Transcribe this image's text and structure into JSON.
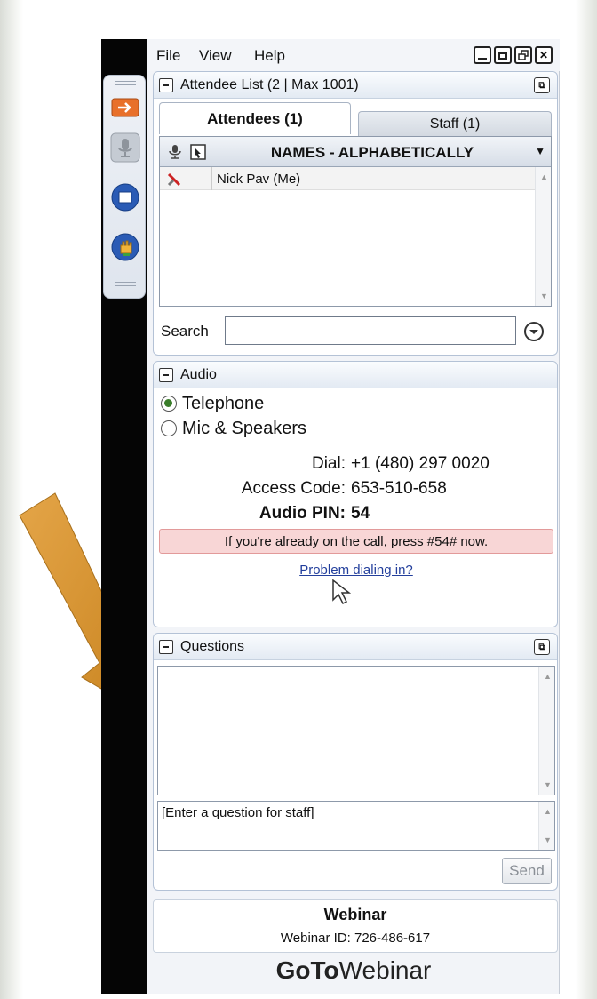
{
  "menu": {
    "file": "File",
    "view": "View",
    "help": "Help"
  },
  "attendee_section": {
    "title": "Attendee List  (2 | Max 1001)",
    "tabs": [
      {
        "label": "Attendees (1)"
      },
      {
        "label": "Staff (1)"
      }
    ],
    "column_header": "NAMES - ALPHABETICALLY",
    "rows": [
      {
        "name": "Nick Pav (Me)"
      }
    ],
    "search_label": "Search",
    "search_value": ""
  },
  "audio_section": {
    "title": "Audio",
    "options": [
      {
        "label": "Telephone",
        "selected": true
      },
      {
        "label": "Mic & Speakers",
        "selected": false
      }
    ],
    "dial_label": "Dial:",
    "dial_value": "+1 (480) 297 0020",
    "access_label": "Access Code:",
    "access_value": "653-510-658",
    "pin_label": "Audio PIN:",
    "pin_value": "54",
    "notice": "If you're already on the call, press #54# now.",
    "help_link": "Problem dialing in?"
  },
  "questions_section": {
    "title": "Questions",
    "input_placeholder": "[Enter a question for staff]",
    "send_label": "Send"
  },
  "footer": {
    "webinar_title": "Webinar",
    "webinar_id": "Webinar ID: 726-486-617",
    "brand_bold": "GoTo",
    "brand_light": "Webinar"
  },
  "colors": {
    "arrow": "#d9962e",
    "notice_bg": "#f8d6d6",
    "link": "#233f9c",
    "brand": "#222222"
  }
}
